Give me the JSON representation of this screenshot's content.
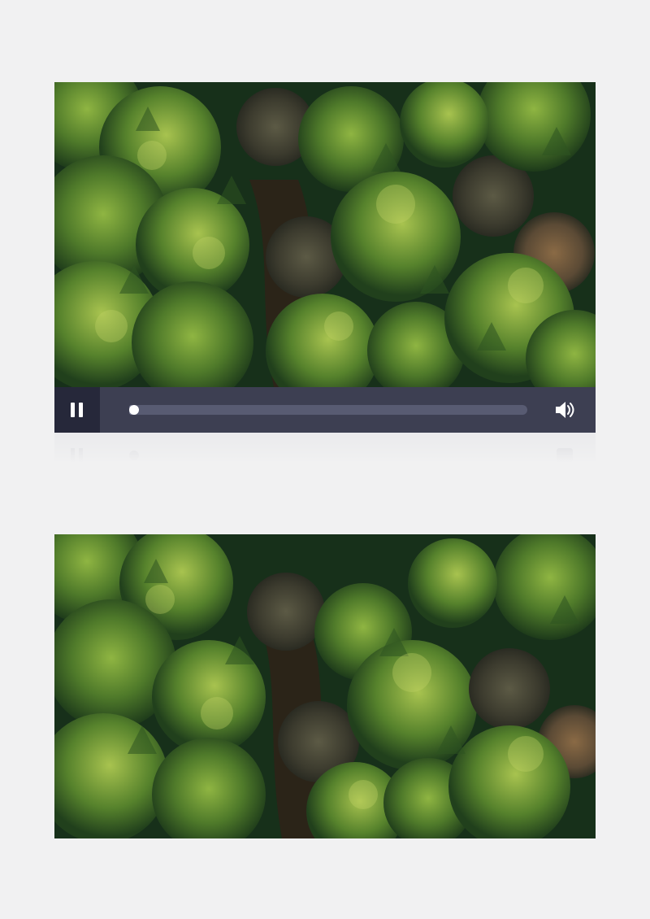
{
  "player": {
    "video_title": "",
    "state": "playing",
    "progress_fraction": 0.0,
    "icons": {
      "play_pause": "pause-icon",
      "volume": "volume-icon"
    }
  },
  "videos": [
    {
      "id": "video-1",
      "content": "aerial-forest-frame"
    },
    {
      "id": "video-2",
      "content": "aerial-forest-frame"
    }
  ],
  "colors": {
    "page_background": "#f1f1f2",
    "control_bar": "#3d3f52",
    "pause_button_background": "#26283a",
    "progress_track": "#585b72",
    "progress_thumb": "#ffffff",
    "icon": "#ffffff"
  }
}
